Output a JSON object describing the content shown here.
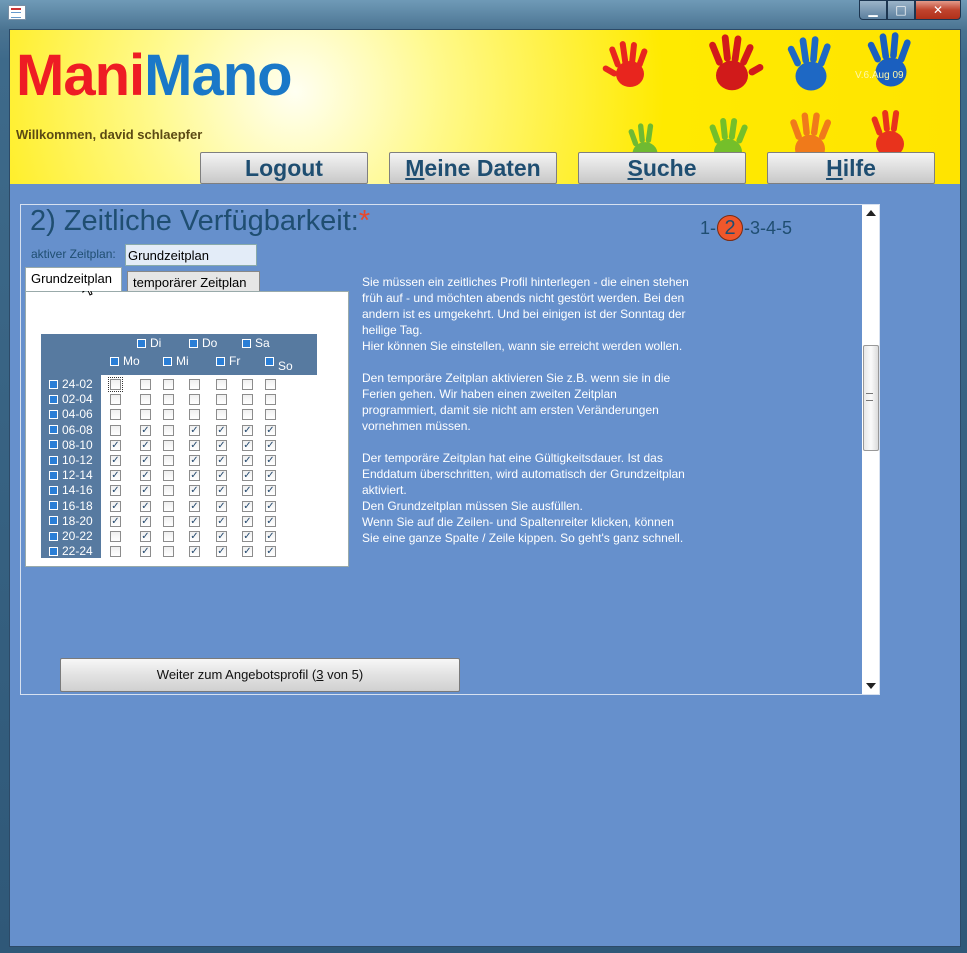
{
  "window": {
    "icon": "form-icon",
    "controls": [
      "minimize-icon",
      "maximize-icon",
      "close-icon"
    ]
  },
  "header": {
    "logo_part1": "Mani",
    "logo_part2": "Mano",
    "welcome": "Willkommen, david schlaepfer",
    "version": "V.6.Aug 09",
    "colors": {
      "background": "#ffe600",
      "logo_red": "#ee1c24",
      "logo_blue": "#1a78c8"
    }
  },
  "nav": {
    "logout": "Logout",
    "meine_daten_access": "M",
    "meine_daten_rest": "eine Daten",
    "suche_access": "S",
    "suche_rest": "uche",
    "hilfe_access": "H",
    "hilfe_rest": "ilfe"
  },
  "page": {
    "title": "2) Zeitliche Verfügbarkeit:",
    "required_mark": "*",
    "steps_before": "1-",
    "steps_current": "2",
    "steps_after": "-3-4-5",
    "aktiv_label": "aktiver Zeitplan:",
    "aktiv_value": "Grundzeitplan"
  },
  "tabs": {
    "active": "Grundzeitplan",
    "inactive": "temporärer Zeitplan"
  },
  "schedule": {
    "days_top": [
      "Di",
      "Do",
      "Sa"
    ],
    "days_bottom": [
      "Mo",
      "Mi",
      "Fr",
      "So"
    ],
    "rows": [
      {
        "label": "24-02",
        "checks": [
          false,
          false,
          false,
          false,
          false,
          false,
          false
        ]
      },
      {
        "label": "02-04",
        "checks": [
          false,
          false,
          false,
          false,
          false,
          false,
          false
        ]
      },
      {
        "label": "04-06",
        "checks": [
          false,
          false,
          false,
          false,
          false,
          false,
          false
        ]
      },
      {
        "label": "06-08",
        "checks": [
          false,
          true,
          false,
          true,
          true,
          true,
          true
        ]
      },
      {
        "label": "08-10",
        "checks": [
          true,
          true,
          false,
          true,
          true,
          true,
          true
        ]
      },
      {
        "label": "10-12",
        "checks": [
          true,
          true,
          false,
          true,
          true,
          true,
          true
        ]
      },
      {
        "label": "12-14",
        "checks": [
          true,
          true,
          false,
          true,
          true,
          true,
          true
        ]
      },
      {
        "label": "14-16",
        "checks": [
          true,
          true,
          false,
          true,
          true,
          true,
          true
        ]
      },
      {
        "label": "16-18",
        "checks": [
          true,
          true,
          false,
          true,
          true,
          true,
          true
        ]
      },
      {
        "label": "18-20",
        "checks": [
          true,
          true,
          false,
          true,
          true,
          true,
          true
        ]
      },
      {
        "label": "20-22",
        "checks": [
          false,
          true,
          false,
          true,
          true,
          true,
          true
        ]
      },
      {
        "label": "22-24",
        "checks": [
          false,
          true,
          false,
          true,
          true,
          true,
          true
        ]
      }
    ]
  },
  "info": {
    "p1": "Sie müssen ein zeitliches Profil hinterlegen - die einen stehen früh auf - und möchten abends nicht gestört werden. Bei den andern ist es umgekehrt. Und bei einigen ist der Sonntag der heilige Tag.",
    "p1b": "Hier können Sie einstellen, wann sie erreicht werden wollen.",
    "p2": "Den temporäre Zeitplan aktivieren Sie z.B. wenn sie in die Ferien gehen. Wir haben einen zweiten Zeitplan programmiert, damit sie nicht am ersten Veränderungen vornehmen müssen.",
    "p3": "Der temporäre Zeitplan hat eine Gültigkeitsdauer. Ist das Enddatum überschritten, wird automatisch der Grundzeitplan aktiviert.",
    "p3b": "Den Grundzeitplan müssen Sie ausfüllen.",
    "p3c": "Wenn Sie auf die Zeilen- und Spaltenreiter klicken, können Sie eine ganze Spalte / Zeile kippen. So geht's ganz schnell."
  },
  "next_button": {
    "before": "Weiter zum Angebotsprofil (",
    "access": "3",
    "after": " von 5)"
  }
}
